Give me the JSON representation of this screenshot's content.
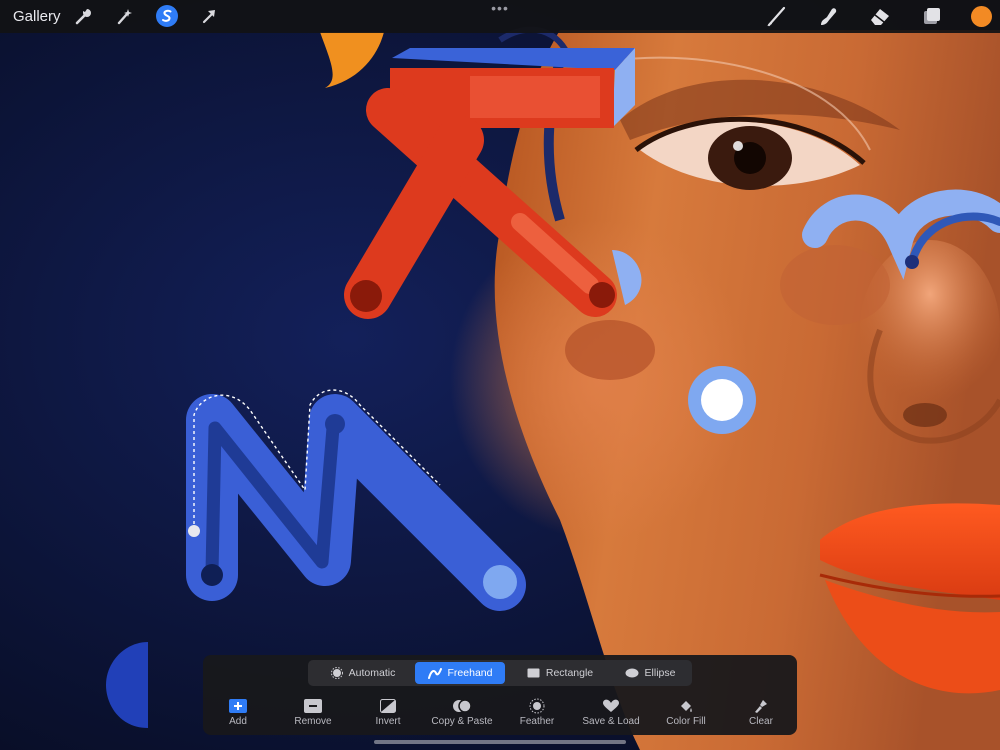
{
  "topbar": {
    "gallery_label": "Gallery",
    "left_icons": [
      "wrench-icon",
      "magic-wand-icon",
      "selection-icon",
      "transform-arrow-icon"
    ],
    "more_label": "•••",
    "right_icons": [
      "brush-icon",
      "smudge-icon",
      "eraser-icon",
      "layers-icon"
    ],
    "current_color": "#f28a24"
  },
  "selection_panel": {
    "modes": [
      {
        "label": "Automatic",
        "icon": "automatic-icon",
        "active": false
      },
      {
        "label": "Freehand",
        "icon": "freehand-icon",
        "active": true
      },
      {
        "label": "Rectangle",
        "icon": "rectangle-icon",
        "active": false
      },
      {
        "label": "Ellipse",
        "icon": "ellipse-icon",
        "active": false
      }
    ],
    "actions": [
      {
        "label": "Add",
        "icon": "add-icon"
      },
      {
        "label": "Remove",
        "icon": "remove-icon"
      },
      {
        "label": "Invert",
        "icon": "invert-icon"
      },
      {
        "label": "Copy & Paste",
        "icon": "copy-paste-icon"
      },
      {
        "label": "Feather",
        "icon": "feather-icon"
      },
      {
        "label": "Save & Load",
        "icon": "save-load-icon"
      },
      {
        "label": "Color Fill",
        "icon": "color-fill-icon"
      },
      {
        "label": "Clear",
        "icon": "clear-icon"
      }
    ]
  },
  "colors": {
    "accent": "#2f7cf6",
    "toolbar_bg": "#121214",
    "canvas_bg": "#0b1431",
    "red_shape": "#e03a1e",
    "blue_shape": "#3a5fd6",
    "light_blue_shape": "#7fa8f0"
  }
}
